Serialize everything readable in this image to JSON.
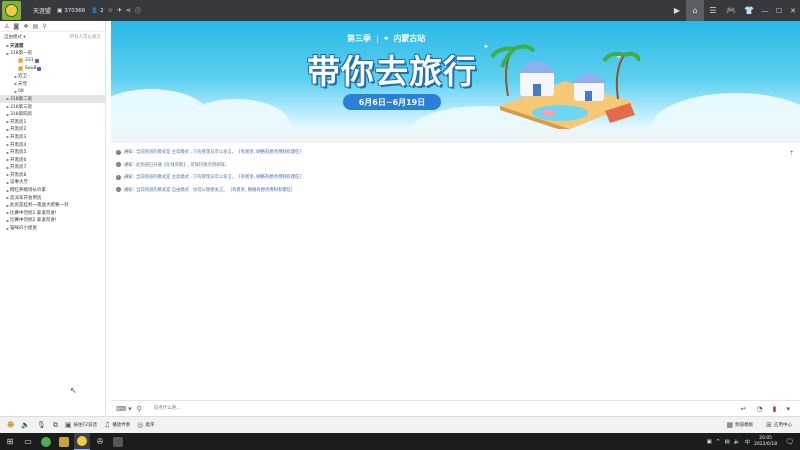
{
  "titlebar": {
    "title": "天涯盟",
    "room_id": "370366",
    "user_count": "2",
    "icons": [
      "logo-icon",
      "id-icon",
      "user-icon",
      "star-icon",
      "unit-icon",
      "share-icon",
      "info-icon"
    ],
    "right_icons": [
      "video-icon",
      "home-icon",
      "list-icon",
      "gamepad-icon",
      "tshirt-icon",
      "minimize-icon",
      "maximize-icon",
      "close-icon"
    ]
  },
  "sidebar": {
    "mode_label": "自由模式",
    "manage_label": "所有人可以发言",
    "channels": [
      {
        "label": "天涯盟",
        "level": "root",
        "bold": true
      },
      {
        "label": "318第一房",
        "level": "root"
      },
      {
        "label": "331",
        "level": "user"
      },
      {
        "label": "Sou8",
        "level": "user"
      },
      {
        "label": "近卫",
        "level": "sub"
      },
      {
        "label": "天穹",
        "level": "sub"
      },
      {
        "label": "08",
        "level": "sub"
      },
      {
        "label": "318第二房",
        "level": "root",
        "selected": true
      },
      {
        "label": "318第三房",
        "level": "root"
      },
      {
        "label": "318第四房",
        "level": "root"
      },
      {
        "label": "开黑房1",
        "level": "root"
      },
      {
        "label": "开黑房2",
        "level": "root"
      },
      {
        "label": "开黑房3",
        "level": "root"
      },
      {
        "label": "开黑房4",
        "level": "root"
      },
      {
        "label": "开黑房5",
        "level": "root"
      },
      {
        "label": "开黑房6",
        "level": "root"
      },
      {
        "label": "开黑房7",
        "level": "root"
      },
      {
        "label": "开黑房8",
        "level": "root"
      },
      {
        "label": "议事大厅",
        "level": "root"
      },
      {
        "label": "网红养殖场长の家",
        "level": "root"
      },
      {
        "label": "反派军开会用房",
        "level": "root"
      },
      {
        "label": "此房是挂机一夜送大佬要一对",
        "level": "root"
      },
      {
        "label": "比赛中勿扰1 拿道勿进!",
        "level": "root"
      },
      {
        "label": "比赛中勿扰2 拿道勿进!",
        "level": "root"
      },
      {
        "label": "猫咪の小屋屋",
        "level": "root"
      }
    ]
  },
  "banner": {
    "season": "第三季",
    "location": "内蒙古站",
    "headline": "带你去旅行",
    "dates": "6月6日~6月19日"
  },
  "messages": [
    {
      "label": "通知:",
      "text": "当前频道的模式是 主席模式 , 只有管理员可以发言。",
      "link": "[有易亲, 网络有想点用制有理任]"
    },
    {
      "label": "通知:",
      "text": "此频道已开通【在线背歌】, 可保持歌点用权限。",
      "link": ""
    },
    {
      "label": "通知:",
      "text": "当前频道的模式是 主席模式 , 只有管理员可以发言。",
      "link": "[有易亲, 网络有想点用制有理任]"
    },
    {
      "label": "通知:",
      "text": "当前频道的模式是 自由模式 , 你可以随便发言。",
      "link": "[有易亲, 网络有想点用制有理任]"
    }
  ],
  "input": {
    "placeholder": "说点什么吧..."
  },
  "bottombar": {
    "items": [
      "按住F2说话",
      "播放伴奏",
      "麦序"
    ],
    "right_label": "频道模板",
    "app_center": "应用中心"
  },
  "taskbar": {
    "time": "20:05",
    "date": "2022/6/18"
  },
  "colors": {
    "titlebar_bg": "#37393d",
    "banner_sky": "#29b8e6",
    "selected_row": "#e6e6e6",
    "link_text": "#3a64b0"
  }
}
